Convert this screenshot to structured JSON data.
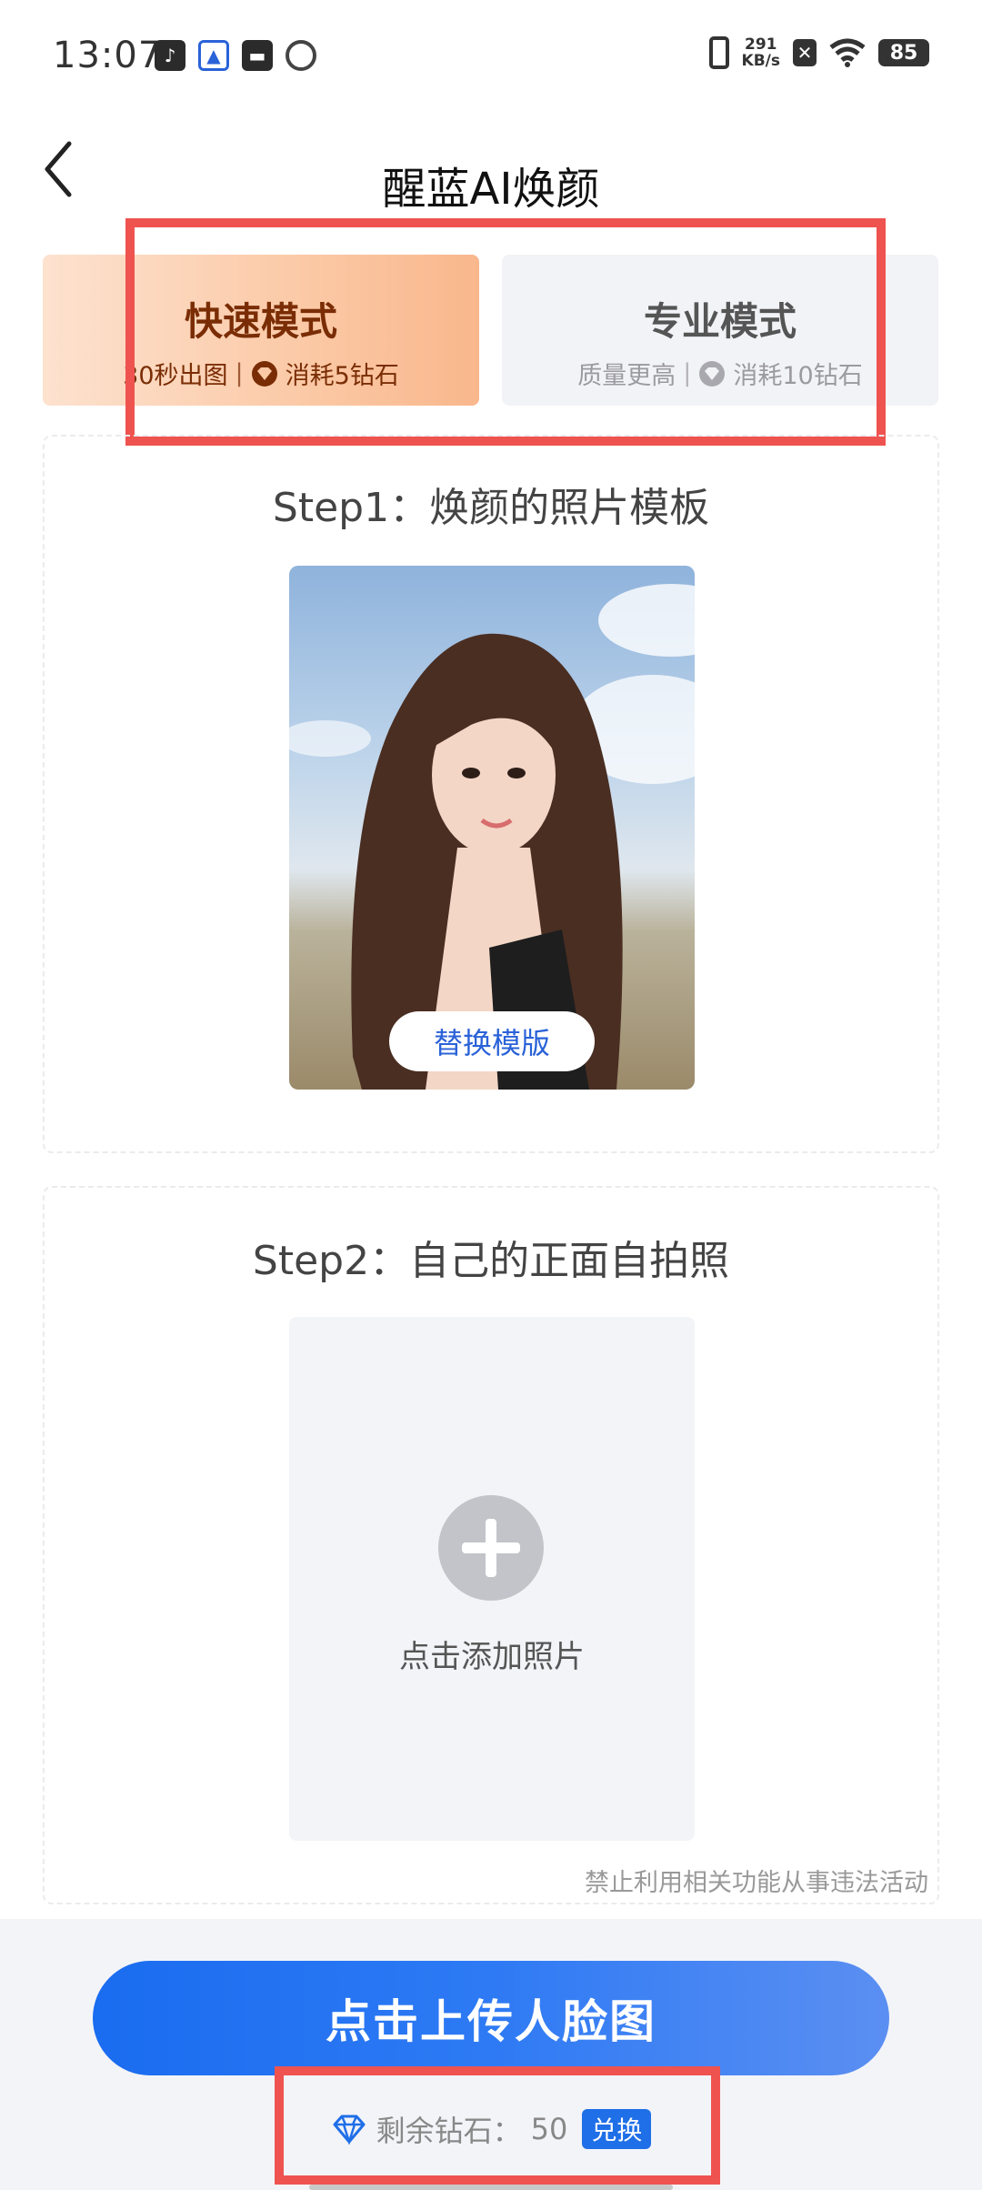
{
  "status_bar": {
    "time": "13:07",
    "net_speed_value": "291",
    "net_speed_unit": "KB/s",
    "battery": "85"
  },
  "nav": {
    "title": "醒蓝AI焕颜"
  },
  "modes": {
    "fast": {
      "title": "快速模式",
      "speed": "30秒出图",
      "cost": "消耗5钻石",
      "selected": true
    },
    "pro": {
      "title": "专业模式",
      "quality": "质量更高",
      "cost": "消耗10钻石",
      "selected": false
    }
  },
  "step1": {
    "title": "Step1：焕颜的照片模板",
    "replace_label": "替换模版"
  },
  "step2": {
    "title": "Step2：自己的正面自拍照",
    "add_label": "点击添加照片"
  },
  "legal_note": "禁止利用相关功能从事违法活动",
  "bottom": {
    "upload_label": "点击上传人脸图",
    "balance_label": "剩余钻石：",
    "balance_value": "50",
    "exchange_label": "兑换"
  },
  "colors": {
    "accent_blue": "#1a6cf0",
    "highlight_red": "#ef5350",
    "fast_mode_text": "#7a2d05"
  }
}
